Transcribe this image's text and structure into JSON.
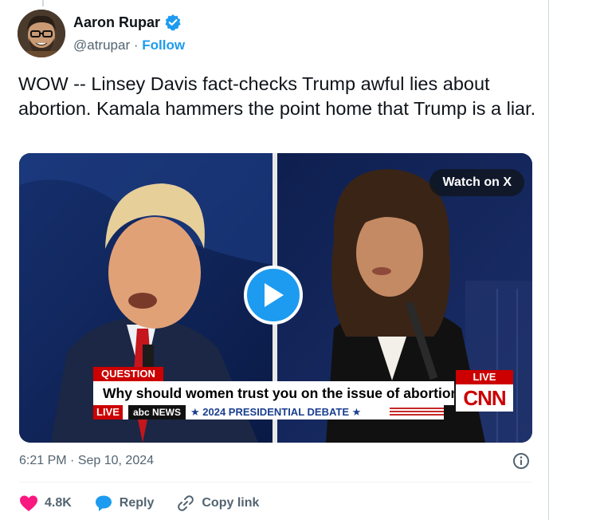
{
  "author": {
    "display_name": "Aaron Rupar",
    "handle": "@atrupar",
    "separator": "·",
    "follow_label": "Follow"
  },
  "tweet": {
    "text": "WOW -- Linsey Davis fact-checks Trump awful lies about abortion. Kamala hammers the point home that Trump is a liar."
  },
  "media": {
    "watch_label": "Watch on X",
    "chyron": {
      "question_tag": "QUESTION",
      "question_text": "Why should women trust you on the issue of abortion?",
      "live_tag": "LIVE",
      "network": "abc NEWS",
      "debate_title": "★ 2024 PRESIDENTIAL DEBATE ★",
      "cnn_live": "LIVE",
      "cnn_logo": "CNN"
    }
  },
  "meta": {
    "time": "6:21 PM",
    "separator": "·",
    "date": "Sep 10, 2024"
  },
  "actions": {
    "like_count": "4.8K",
    "reply_label": "Reply",
    "copy_link_label": "Copy link"
  },
  "colors": {
    "accent": "#1d9bf0",
    "like": "#f91880",
    "secondary_text": "#536471"
  }
}
